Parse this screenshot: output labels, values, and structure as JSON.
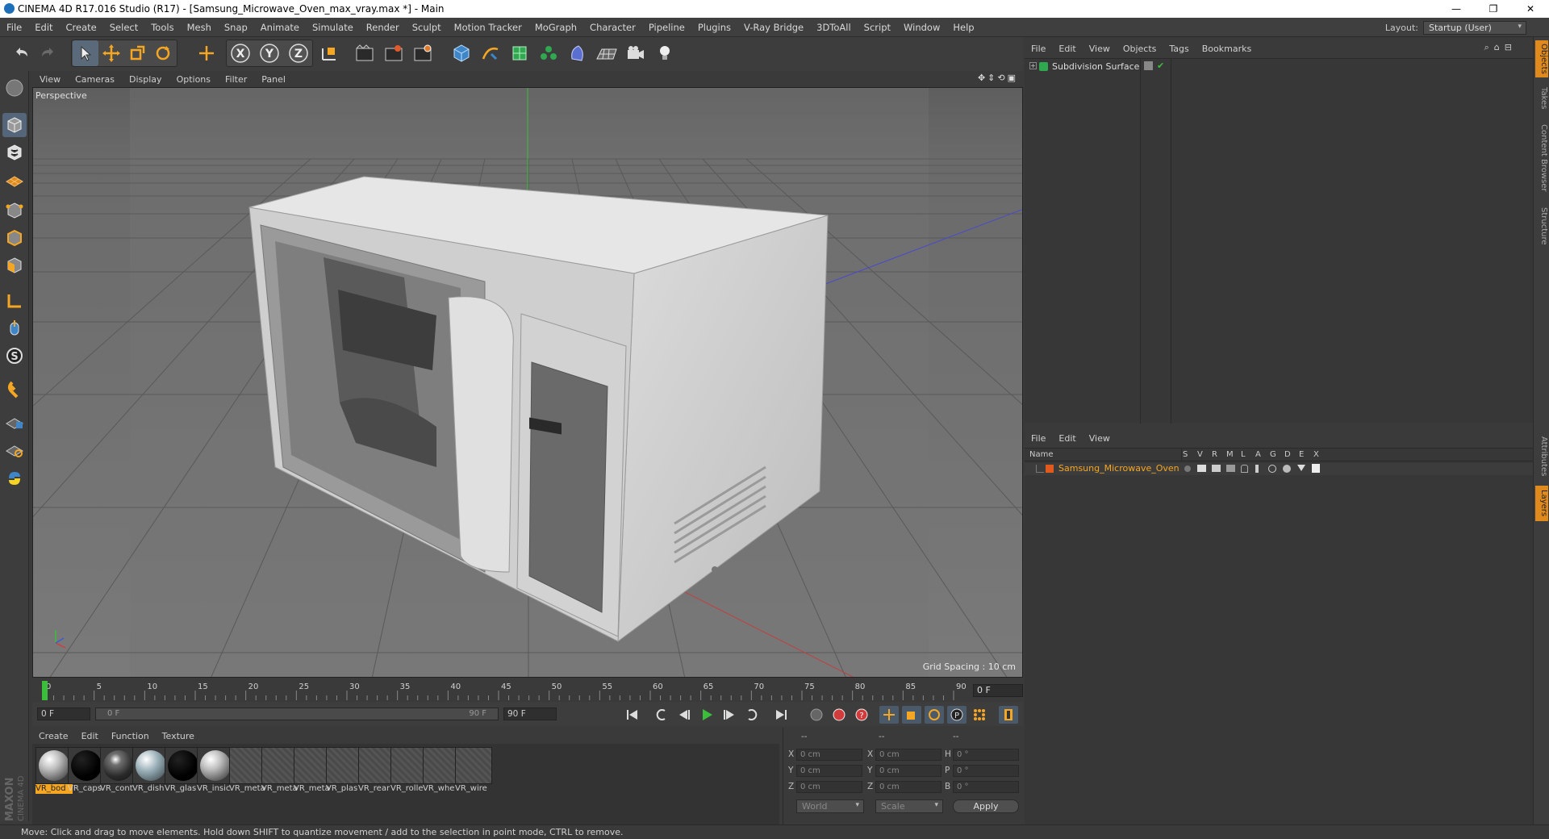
{
  "window": {
    "title": "CINEMA 4D R17.016 Studio (R17) - [Samsung_Microwave_Oven_max_vray.max *] - Main",
    "minimize": "—",
    "restore": "❐",
    "close": "✕"
  },
  "menubar": {
    "items": [
      "File",
      "Edit",
      "Create",
      "Select",
      "Tools",
      "Mesh",
      "Snap",
      "Animate",
      "Simulate",
      "Render",
      "Sculpt",
      "Motion Tracker",
      "MoGraph",
      "Character",
      "Pipeline",
      "Plugins",
      "V-Ray Bridge",
      "3DToAll",
      "Script",
      "Window",
      "Help"
    ],
    "layout_label": "Layout:",
    "layout_value": "Startup (User)"
  },
  "toolbar": {
    "icons": [
      "undo-icon",
      "redo-icon",
      "select-arrow-icon",
      "move-icon",
      "scale-icon",
      "rotate-icon",
      "live-select-icon",
      "x-axis-icon",
      "y-axis-icon",
      "z-axis-icon",
      "coordinate-system-icon",
      "render-view-icon",
      "render-picture-viewer-icon",
      "render-settings-icon",
      "cube-icon",
      "pen-icon",
      "subdivision-icon",
      "cloner-icon",
      "deformer-icon",
      "floor-icon",
      "camera-icon",
      "light-icon"
    ],
    "axis_x": "X",
    "axis_y": "Y",
    "axis_z": "Z"
  },
  "viewport": {
    "menu": [
      "View",
      "Cameras",
      "Display",
      "Options",
      "Filter",
      "Panel"
    ],
    "camera_label": "Perspective",
    "grid_spacing": "Grid Spacing : 10 cm"
  },
  "timeline": {
    "ticks": [
      "0",
      "5",
      "10",
      "15",
      "20",
      "25",
      "30",
      "35",
      "40",
      "45",
      "50",
      "55",
      "60",
      "65",
      "70",
      "75",
      "80",
      "85",
      "90"
    ],
    "current_frame": "0 F",
    "start_field": "0 F",
    "range_start": "0 F",
    "range_end": "90 F",
    "end_field": "90 F"
  },
  "materials": {
    "menu": [
      "Create",
      "Edit",
      "Function",
      "Texture"
    ],
    "items": [
      {
        "label": "VR_bod",
        "kind": "grey"
      },
      {
        "label": "VR_caps",
        "kind": "black"
      },
      {
        "label": "VR_cont",
        "kind": "darkgrey"
      },
      {
        "label": "VR_dish",
        "kind": "glass"
      },
      {
        "label": "VR_glas",
        "kind": "black"
      },
      {
        "label": "VR_insic",
        "kind": "grey"
      },
      {
        "label": "VR_meta",
        "kind": "flat"
      },
      {
        "label": "VR_meta",
        "kind": "flat"
      },
      {
        "label": "VR_meta",
        "kind": "flat"
      },
      {
        "label": "VR_plas",
        "kind": "flat"
      },
      {
        "label": "VR_rear",
        "kind": "flat"
      },
      {
        "label": "VR_rolle",
        "kind": "flat"
      },
      {
        "label": "VR_whe",
        "kind": "flat"
      },
      {
        "label": "VR_wire",
        "kind": "flat"
      }
    ]
  },
  "coordinates": {
    "header": [
      "--",
      "--",
      "--"
    ],
    "rows": [
      {
        "a_label": "X",
        "a_val": "0 cm",
        "b_label": "X",
        "b_val": "0 cm",
        "c_label": "H",
        "c_val": "0 °"
      },
      {
        "a_label": "Y",
        "a_val": "0 cm",
        "b_label": "Y",
        "b_val": "0 cm",
        "c_label": "P",
        "c_val": "0 °"
      },
      {
        "a_label": "Z",
        "a_val": "0 cm",
        "b_label": "Z",
        "b_val": "0 cm",
        "c_label": "B",
        "c_val": "0 °"
      }
    ],
    "mode_world": "World",
    "mode_scale": "Scale",
    "apply": "Apply"
  },
  "objects_panel": {
    "menu": [
      "File",
      "Edit",
      "View",
      "Objects",
      "Tags",
      "Bookmarks"
    ],
    "items": [
      {
        "name": "Subdivision Surface"
      }
    ]
  },
  "layers_panel": {
    "menu": [
      "File",
      "Edit",
      "View"
    ],
    "columns": [
      "Name",
      "S",
      "V",
      "R",
      "M",
      "L",
      "A",
      "G",
      "D",
      "E",
      "X"
    ],
    "rows": [
      {
        "name": "Samsung_Microwave_Oven"
      }
    ]
  },
  "right_tabs": [
    "Objects",
    "Takes",
    "Content Browser",
    "Structure",
    "Attributes",
    "Layers"
  ],
  "status": {
    "text": "Move: Click and drag to move elements. Hold down SHIFT to quantize movement / add to the selection in point mode, CTRL to remove."
  },
  "logo": {
    "brand": "MAXON",
    "product": "CINEMA 4D"
  },
  "colors": {
    "accent_orange": "#f5a623",
    "selection_orange": "#e08a1e",
    "axis_green": "#3bbf3b",
    "axis_red": "#d23b3b",
    "axis_blue": "#3b5bd2"
  }
}
